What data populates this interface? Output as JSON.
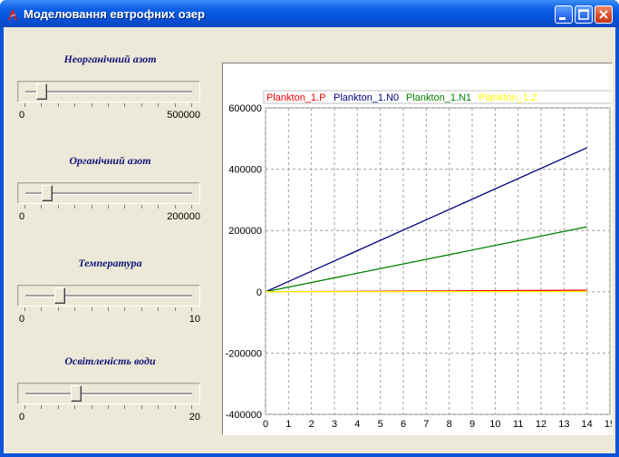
{
  "window": {
    "title": "Моделювання евтрофних озер",
    "buttons": [
      "minimize",
      "maximize",
      "close"
    ]
  },
  "sliders": [
    {
      "id": "inorganic-nitrogen",
      "label": "Неорганічний азот",
      "min_label": "0",
      "max_label": "500000",
      "value_fraction": 0.09
    },
    {
      "id": "organic-nitrogen",
      "label": "Органічний азот",
      "min_label": "0",
      "max_label": "200000",
      "value_fraction": 0.12
    },
    {
      "id": "temperature",
      "label": "Температура",
      "min_label": "0",
      "max_label": "10",
      "value_fraction": 0.2
    },
    {
      "id": "water-illumination",
      "label": "Освітленість води",
      "min_label": "0",
      "max_label": "20",
      "value_fraction": 0.3
    }
  ],
  "chart_data": {
    "type": "line",
    "legend": [
      {
        "name": "Plankton_1.P",
        "color": "#ff0000"
      },
      {
        "name": "Plankton_1.N0",
        "color": "#000080"
      },
      {
        "name": "Plankton_1.N1",
        "color": "#008000"
      },
      {
        "name": "Plankton_1.Z",
        "color": "#ffff00"
      }
    ],
    "legend_position": "top",
    "x_ticks": [
      "0",
      "1",
      "2",
      "3",
      "4",
      "5",
      "6",
      "7",
      "8",
      "9",
      "10",
      "11",
      "12",
      "13",
      "14",
      "15"
    ],
    "y_ticks": [
      "600000",
      "400000",
      "200000",
      "0",
      "-200000",
      "-400000"
    ],
    "xlim": [
      0,
      15
    ],
    "ylim": [
      -400000,
      600000
    ],
    "grid": true,
    "series": [
      {
        "name": "Plankton_1.P",
        "color": "#ff0000",
        "x": [
          0,
          14
        ],
        "y": [
          0,
          5000
        ]
      },
      {
        "name": "Plankton_1.N0",
        "color": "#000080",
        "x": [
          0,
          14
        ],
        "y": [
          0,
          470000
        ]
      },
      {
        "name": "Plankton_1.N1",
        "color": "#008000",
        "x": [
          0,
          14
        ],
        "y": [
          0,
          212000
        ]
      },
      {
        "name": "Plankton_1.Z",
        "color": "#ffff00",
        "x": [
          0,
          14
        ],
        "y": [
          0,
          1000
        ]
      }
    ]
  }
}
